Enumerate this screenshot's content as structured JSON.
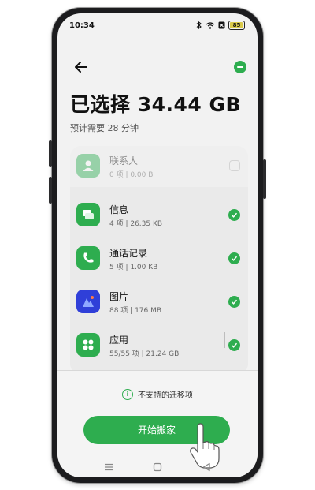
{
  "status": {
    "time": "10:34",
    "battery": "85"
  },
  "header": {
    "title": "已选择 34.44 GB",
    "subtitle": "预计需要 28 分钟"
  },
  "items": [
    {
      "name": "联系人",
      "meta": "0 项 | 0.00 B",
      "icon": "contacts-icon",
      "selected": false
    },
    {
      "name": "信息",
      "meta": "4 项 | 26.35 KB",
      "icon": "message-icon",
      "selected": true
    },
    {
      "name": "通话记录",
      "meta": "5 项 | 1.00 KB",
      "icon": "phone-icon",
      "selected": true
    },
    {
      "name": "图片",
      "meta": "88 项 | 176 MB",
      "icon": "photos-icon",
      "selected": true
    },
    {
      "name": "应用",
      "meta": "55/55 项 | 21.24 GB",
      "icon": "apps-icon",
      "selected": true
    }
  ],
  "footer": {
    "unsupported_label": "不支持的迁移项",
    "start_label": "开始搬家"
  },
  "colors": {
    "accent": "#2ead4f",
    "photos": "#2f3fd8"
  }
}
